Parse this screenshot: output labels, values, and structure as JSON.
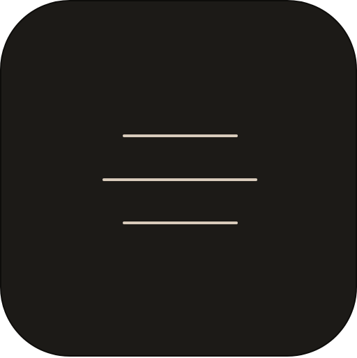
{
  "icon": {
    "semantic": "menu-icon",
    "description_name": "hamburger-menu",
    "background_color": "#1c1a17",
    "stroke_color": "#d8cbbb",
    "bar_count": 3
  }
}
